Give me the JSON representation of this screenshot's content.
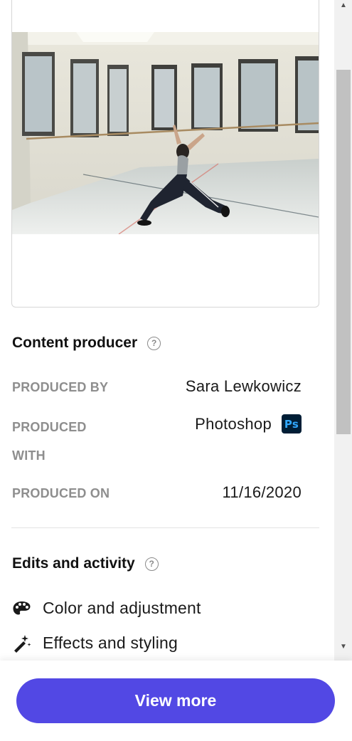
{
  "content_producer": {
    "title": "Content producer",
    "help_glyph": "?",
    "rows": [
      {
        "label": "PRODUCED BY",
        "value": "Sara Lewkowicz"
      },
      {
        "label_line1": "PRODUCED",
        "label_line2": "WITH",
        "value": "Photoshop",
        "badge": "Ps"
      },
      {
        "label": "PRODUCED ON",
        "value": "11/16/2020"
      }
    ]
  },
  "edits": {
    "title": "Edits and activity",
    "help_glyph": "?",
    "items": [
      {
        "label": "Color and adjustment",
        "icon": "palette-icon"
      },
      {
        "label": "Effects and styling",
        "icon": "magic-wand-icon"
      }
    ]
  },
  "footer": {
    "button_label": "View more"
  },
  "colors": {
    "accent": "#5248e4",
    "photoshop_badge_bg": "#001e36",
    "photoshop_badge_fg": "#31a8ff",
    "label_gray": "#8e8e8e"
  }
}
